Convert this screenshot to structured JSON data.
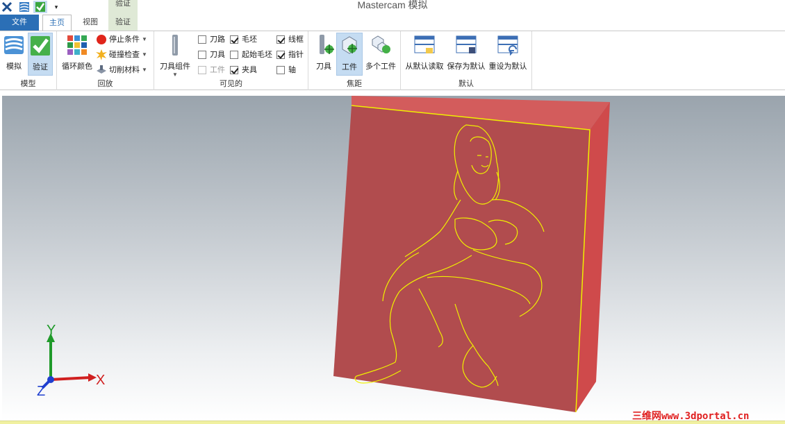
{
  "app_title": "Mastercam 模拟",
  "context_tab_label": "验证",
  "tabs": {
    "file": "文件",
    "home": "主页",
    "view": "视图",
    "verify": "验证"
  },
  "ribbon": {
    "model": {
      "label": "模型",
      "simulate": "模拟",
      "verify": "验证"
    },
    "playback": {
      "label": "回放",
      "cycle_colors": "循环颜色",
      "stop_conditions": "停止条件",
      "collision_check": "碰撞检查",
      "cut_material": "切削材料"
    },
    "visible": {
      "label": "可见的",
      "tool_assembly": "刀具组件",
      "checkboxes": [
        {
          "label": "刀路",
          "checked": false,
          "disabled": false
        },
        {
          "label": "刀具",
          "checked": false,
          "disabled": false
        },
        {
          "label": "工件",
          "checked": false,
          "disabled": true
        },
        {
          "label": "毛坯",
          "checked": true,
          "disabled": false
        },
        {
          "label": "起始毛坯",
          "checked": false,
          "disabled": false
        },
        {
          "label": "夹具",
          "checked": true,
          "disabled": false
        },
        {
          "label": "线框",
          "checked": true,
          "disabled": false
        },
        {
          "label": "指针",
          "checked": true,
          "disabled": false
        },
        {
          "label": "轴",
          "checked": false,
          "disabled": false
        }
      ]
    },
    "focus": {
      "label": "焦距",
      "tool": "刀具",
      "workpiece": "工件",
      "multi_workpiece": "多个工件"
    },
    "defaults": {
      "label": "默认",
      "read": "从默认读取",
      "save": "保存为默认",
      "reset": "重设为默认"
    }
  },
  "axes": {
    "x": "X",
    "y": "Y",
    "z": "Z"
  },
  "watermark": "三维网www.3dportal.cn",
  "colors": {
    "stock_face": "#b14c4e",
    "stock_top": "#d35c5c",
    "stock_side": "#cf4a4b",
    "wireframe": "#f0f000",
    "accent": "#2b6fb6"
  }
}
